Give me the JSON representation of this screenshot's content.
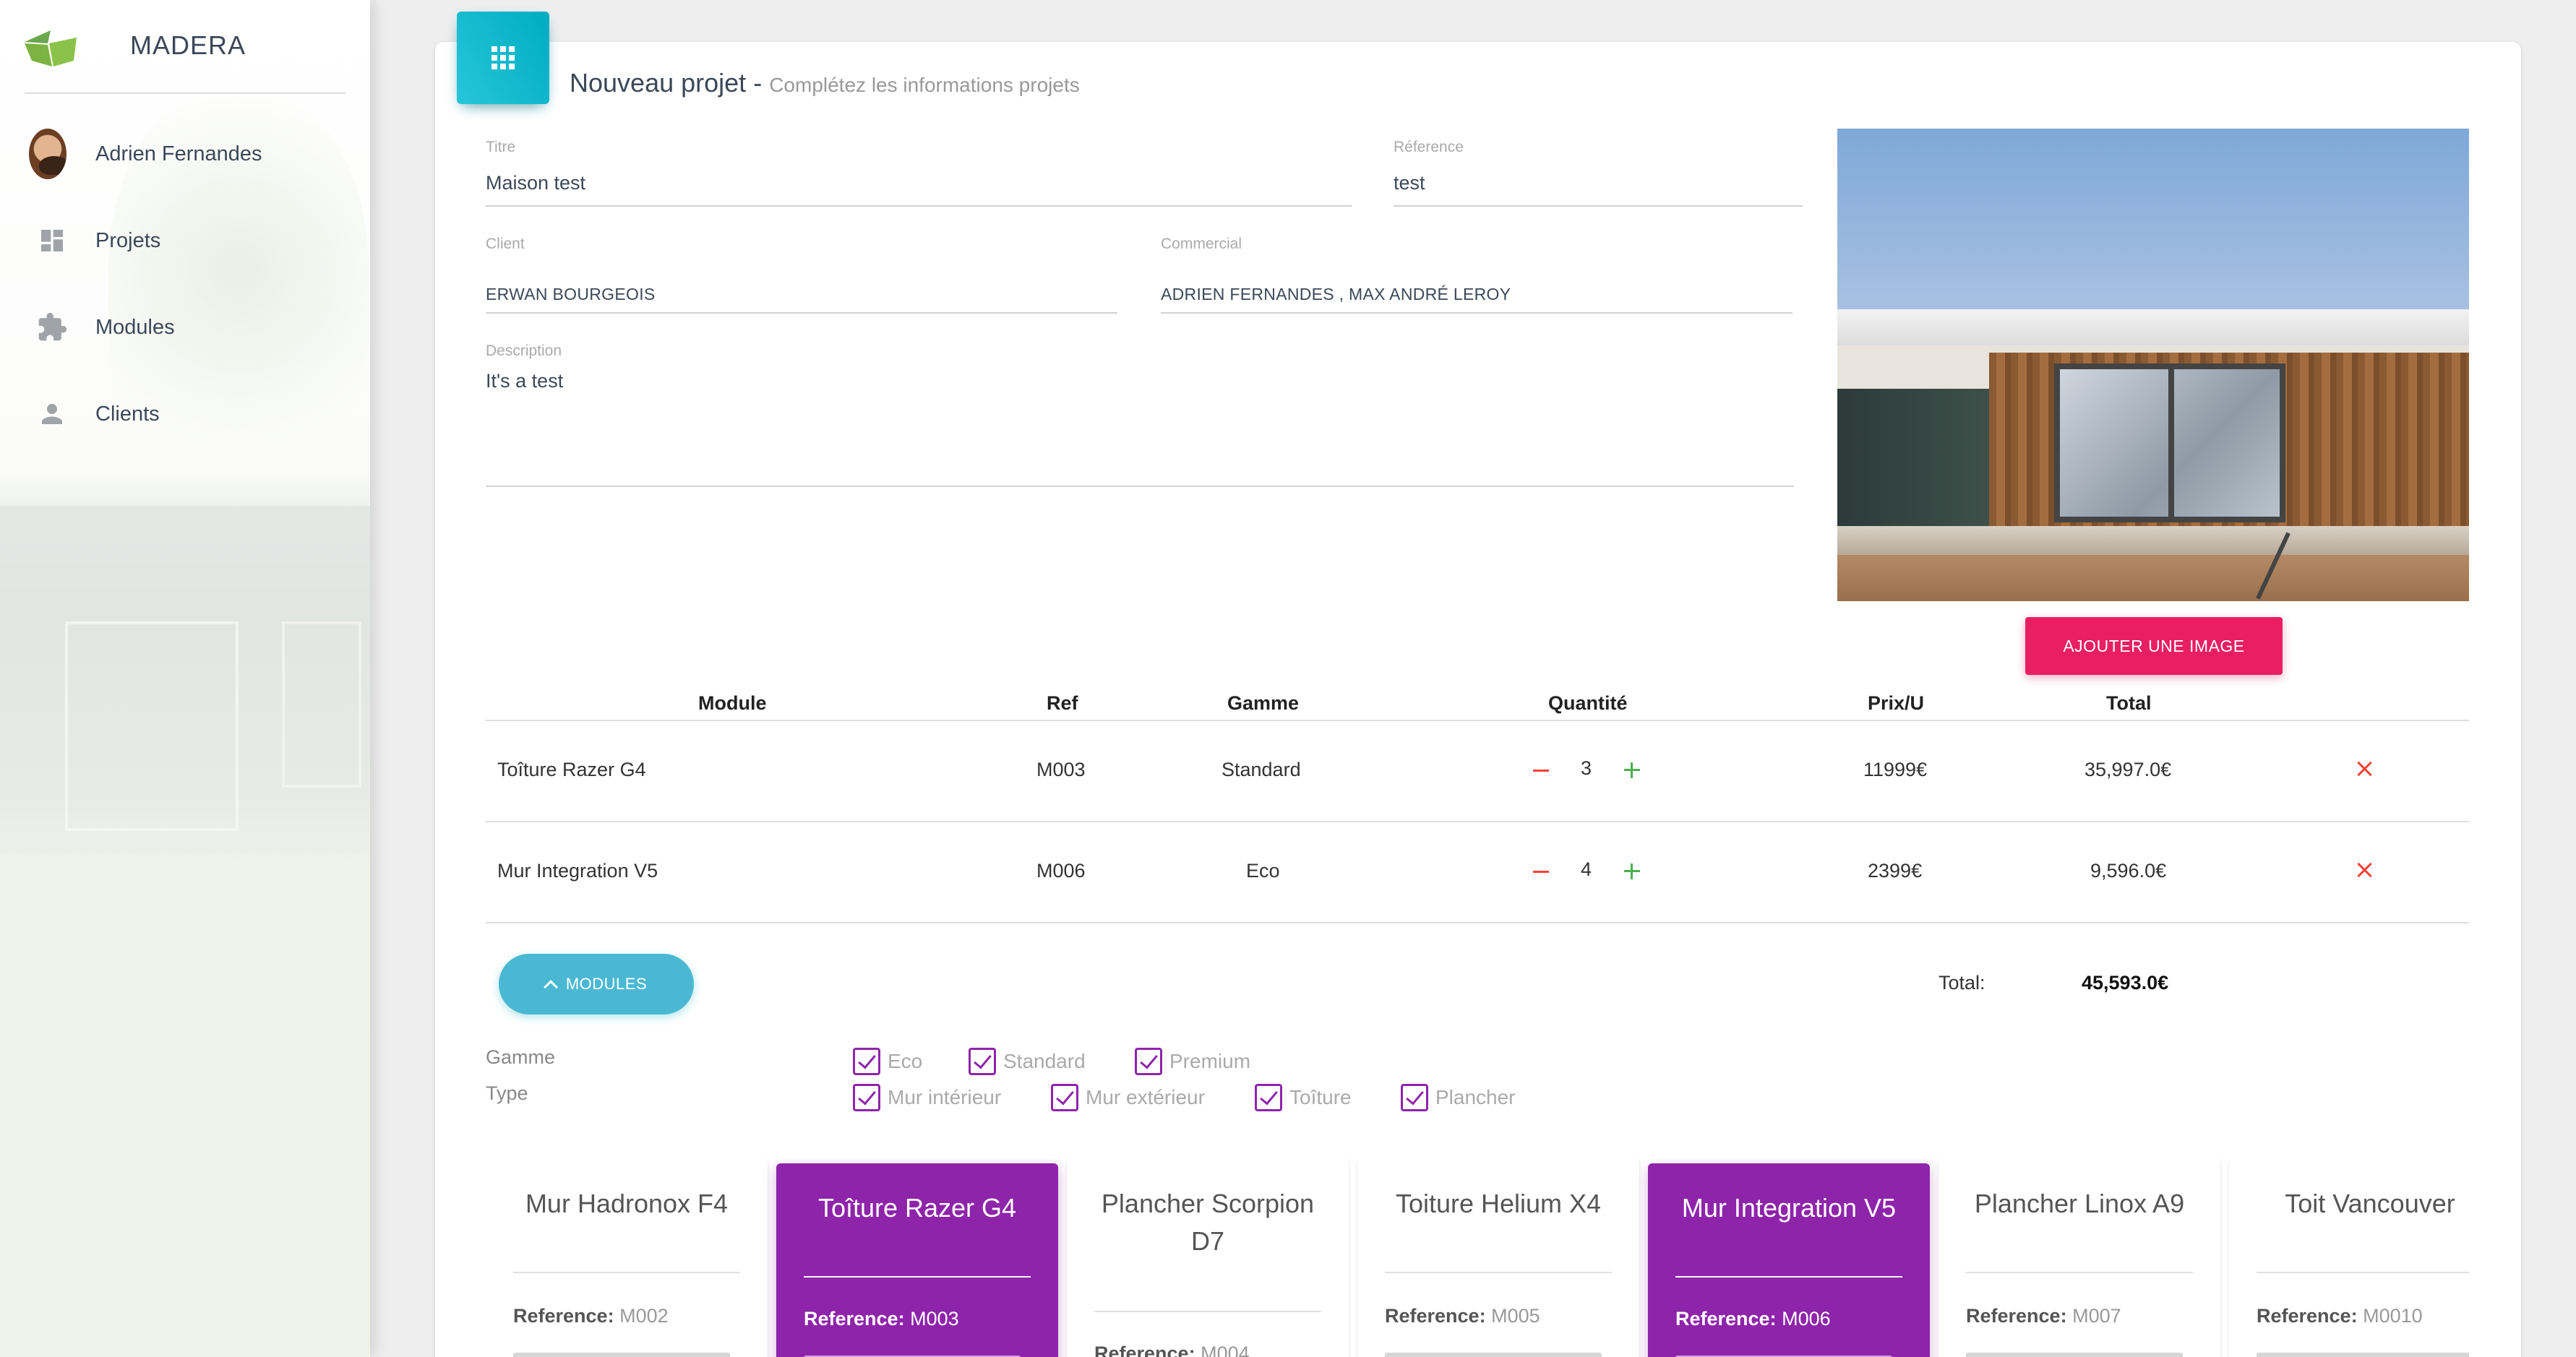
{
  "sidebar": {
    "brand": "MADERA",
    "user": "Adrien Fernandes",
    "items": [
      {
        "label": "Projets",
        "icon": "dashboard-icon"
      },
      {
        "label": "Modules",
        "icon": "puzzle-icon"
      },
      {
        "label": "Clients",
        "icon": "person-icon"
      }
    ]
  },
  "header": {
    "title": "Nouveau projet",
    "separator": "-",
    "subtitle": "Complétez les informations projets",
    "icon": "apps-grid-icon"
  },
  "form": {
    "titre": {
      "label": "Titre",
      "value": "Maison test"
    },
    "reference": {
      "label": "Réference",
      "value": "test"
    },
    "client": {
      "label": "Client",
      "value": "ERWAN BOURGEOIS"
    },
    "commercial": {
      "label": "Commercial",
      "value": "ADRIEN FERNANDES , MAX ANDRÉ LEROY"
    },
    "description": {
      "label": "Description",
      "value": "It's a test"
    }
  },
  "image_button": "AJOUTER UNE IMAGE",
  "table": {
    "headers": [
      "Module",
      "Ref",
      "Gamme",
      "Quantité",
      "Prix/U",
      "Total"
    ],
    "rows": [
      {
        "module": "Toîture Razer G4",
        "ref": "M003",
        "gamme": "Standard",
        "qty": "3",
        "prix": "11999€",
        "total": "35,997.0€"
      },
      {
        "module": "Mur Integration V5",
        "ref": "M006",
        "gamme": "Eco",
        "qty": "4",
        "prix": "2399€",
        "total": "9,596.0€"
      }
    ]
  },
  "modules_button": "MODULES",
  "total": {
    "label": "Total:",
    "value": "45,593.0€"
  },
  "filters": {
    "gamme_label": "Gamme",
    "type_label": "Type",
    "gamme": [
      "Eco",
      "Standard",
      "Premium"
    ],
    "type": [
      "Mur intérieur",
      "Mur extérieur",
      "Toîture",
      "Plancher"
    ]
  },
  "module_cards": [
    {
      "title": "Mur Hadronox F4",
      "ref_label": "Reference:",
      "ref": "M002",
      "selected": false
    },
    {
      "title": "Toîture Razer G4",
      "ref_label": "Reference:",
      "ref": "M003",
      "selected": true
    },
    {
      "title": "Plancher Scorpion D7",
      "ref_label": "Reference:",
      "ref": "M004",
      "selected": false
    },
    {
      "title": "Toiture Helium X4",
      "ref_label": "Reference:",
      "ref": "M005",
      "selected": false
    },
    {
      "title": "Mur Integration V5",
      "ref_label": "Reference:",
      "ref": "M006",
      "selected": true
    },
    {
      "title": "Plancher Linox A9",
      "ref_label": "Reference:",
      "ref": "M007",
      "selected": false
    },
    {
      "title": "Toit Vancouver",
      "ref_label": "Reference:",
      "ref": "M0010",
      "selected": false
    }
  ],
  "colors": {
    "accent_cyan": "#00acc1",
    "accent_pink": "#e91e63",
    "accent_purple": "#8e24aa",
    "minus_red": "#f44336",
    "plus_green": "#4caf50"
  }
}
